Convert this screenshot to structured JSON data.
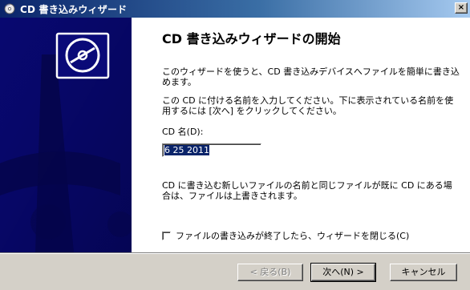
{
  "window": {
    "title": "CD 書き込みウィザード",
    "close_glyph": "×"
  },
  "main": {
    "heading": "CD 書き込みウィザードの開始",
    "intro": "このウィザードを使うと、CD 書き込みデバイスへファイルを簡単に書き込めます。",
    "instruction": "この CD に付ける名前を入力してください。下に表示されている名前を使用するには [次へ] をクリックしてください。",
    "cd_name_label": "CD 名(D):",
    "cd_name_value": "6 25 2011",
    "overwrite_note": "CD に書き込む新しいファイルの名前と同じファイルが既に CD にある場合は、ファイルは上書きされます。",
    "close_checkbox_label": "ファイルの書き込みが終了したら、ウィザードを閉じる(C)",
    "close_checkbox_checked": false
  },
  "buttons": {
    "back": "< 戻る(B)",
    "next": "次へ(N) >",
    "cancel": "キャンセル"
  },
  "colors": {
    "panel_blue": "#0a0a78",
    "panel_dark": "#05054a",
    "title_bar_start": "#0a246a",
    "title_bar_end": "#a6caf0"
  },
  "icons": {
    "title": "cd-burn-icon",
    "banner": "cd-disc-icon"
  }
}
